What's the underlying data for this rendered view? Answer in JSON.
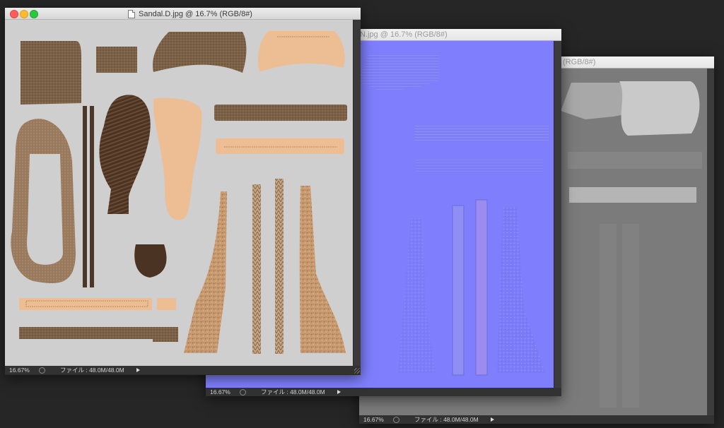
{
  "windows": [
    {
      "id": "sandal-d",
      "title": "Sandal.D.jpg @ 16.7% (RGB/8#)",
      "zoom": "16.67%",
      "file_info": "ファイル : 48.0M/48.0M"
    },
    {
      "id": "sandal-n",
      "title": "N.jpg @ 16.7% (RGB/8#)",
      "zoom": "16.67%",
      "file_info": "ファイル : 48.0M/48.0M"
    },
    {
      "id": "sandal-third",
      "title": "(RGB/8#)",
      "zoom": "16.67%",
      "file_info": "ファイル : 48.0M/48.0M"
    }
  ],
  "colors": {
    "desktop": "#262626",
    "diffuse_bg": "#cfcfcf",
    "normal_bg": "#7f7ffe",
    "gray_bg": "#7b7b7b",
    "fabric": "#7c6248",
    "skin": "#e7b58b",
    "cork": "#c99b70",
    "rubber": "#4a3322"
  }
}
